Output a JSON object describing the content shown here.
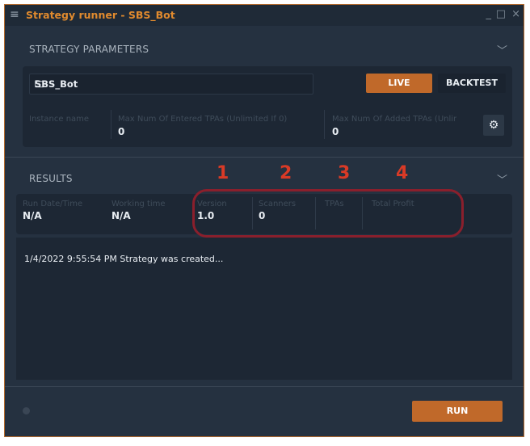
{
  "window": {
    "title": "Strategy runner - SBS_Bot",
    "menu_icon": "hamburger-icon",
    "controls": [
      "_",
      "□",
      "×"
    ]
  },
  "parameters": {
    "section_title": "STRATEGY PARAMETERS",
    "strategy_file": "SBS_Bot",
    "live_label": "LIVE",
    "backtest_label": "BACKTEST",
    "instance_name_label": "Instance name",
    "max_entered_label": "Max Num Of Entered TPAs (Unlimited If 0)",
    "max_entered_value": "0",
    "max_added_label": "Max Num Of Added TPAs (Unlir",
    "max_added_value": "0"
  },
  "results": {
    "section_title": "RESULTS",
    "columns": [
      {
        "label": "Run Date/Time",
        "value": "N/A"
      },
      {
        "label": "Working time",
        "value": "N/A"
      },
      {
        "label": "Version",
        "value": "1.0"
      },
      {
        "label": "Scanners",
        "value": "0"
      },
      {
        "label": "TPAs",
        "value": ""
      },
      {
        "label": "Total Profit",
        "value": ""
      }
    ],
    "annotations": [
      "1",
      "2",
      "3",
      "4"
    ],
    "log": [
      "1/4/2022 9:55:54 PM   Strategy was created..."
    ]
  },
  "footer": {
    "run_label": "RUN"
  },
  "colors": {
    "accent": "#c0692a",
    "title": "#e08a2e",
    "background": "#253140",
    "annotation": "#d93a26"
  }
}
